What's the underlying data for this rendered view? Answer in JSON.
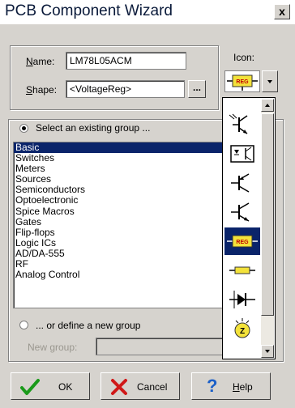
{
  "window": {
    "title": "PCB Component Wizard",
    "close_glyph": "x"
  },
  "name_label_u": "N",
  "name_label_rest": "ame:",
  "name_value": "LM78L05ACM",
  "shape_label_u": "S",
  "shape_label_rest": "hape:",
  "shape_value": "<VoltageReg>",
  "browse_label": "...",
  "icon_label": "Icon:",
  "icon_selected": "REG",
  "select_existing_label": "Select an existing group ...",
  "groups": [
    "Basic",
    "Switches",
    "Meters",
    "Sources",
    "Semiconductors",
    "Optoelectronic",
    "Spice Macros",
    "Gates",
    "Flip-flops",
    "Logic ICs",
    "AD/DA-555",
    "RF",
    "Analog Control"
  ],
  "selected_group": "Basic",
  "define_new_label": "... or define a new group",
  "new_group_label": "New group:",
  "new_group_value": "",
  "icon_options": [
    "npn-transistor",
    "optocoupler",
    "pnp-transistor",
    "npn-transistor-2",
    "regulator",
    "fuse",
    "diode-switch",
    "buzzer"
  ],
  "buttons": {
    "ok": "OK",
    "cancel": "Cancel",
    "help_u": "H",
    "help_rest": "elp"
  }
}
